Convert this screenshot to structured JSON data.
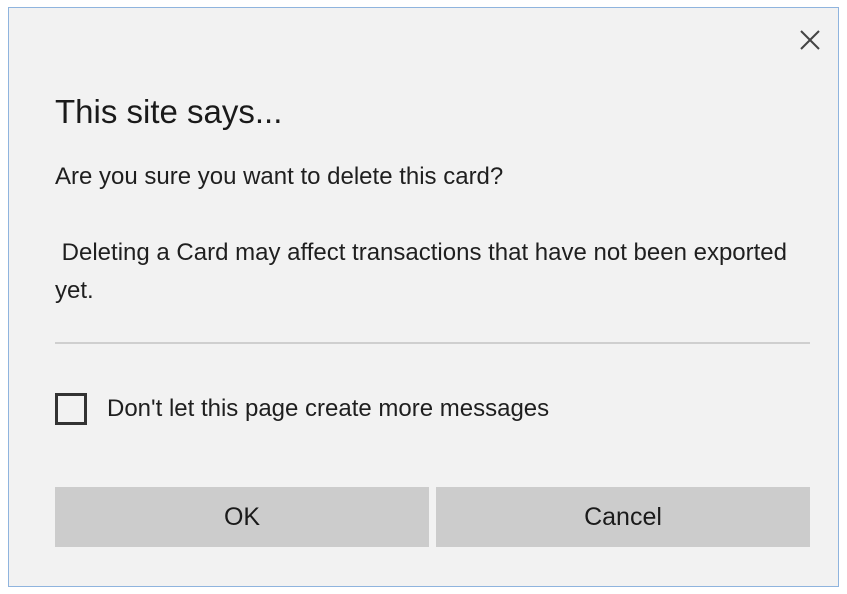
{
  "dialog": {
    "title": "This site says...",
    "message_line1": "Are you sure you want to delete this card?",
    "message_line2": " Deleting a Card may affect transactions that have not been exported yet.",
    "checkbox_label": "Don't let this page create more messages",
    "checkbox_checked": false,
    "ok_label": "OK",
    "cancel_label": "Cancel",
    "close_icon": "close-icon"
  },
  "colors": {
    "dialog_background": "#f2f2f2",
    "button_background": "#cccccc",
    "border_accent": "#8fb4de"
  }
}
